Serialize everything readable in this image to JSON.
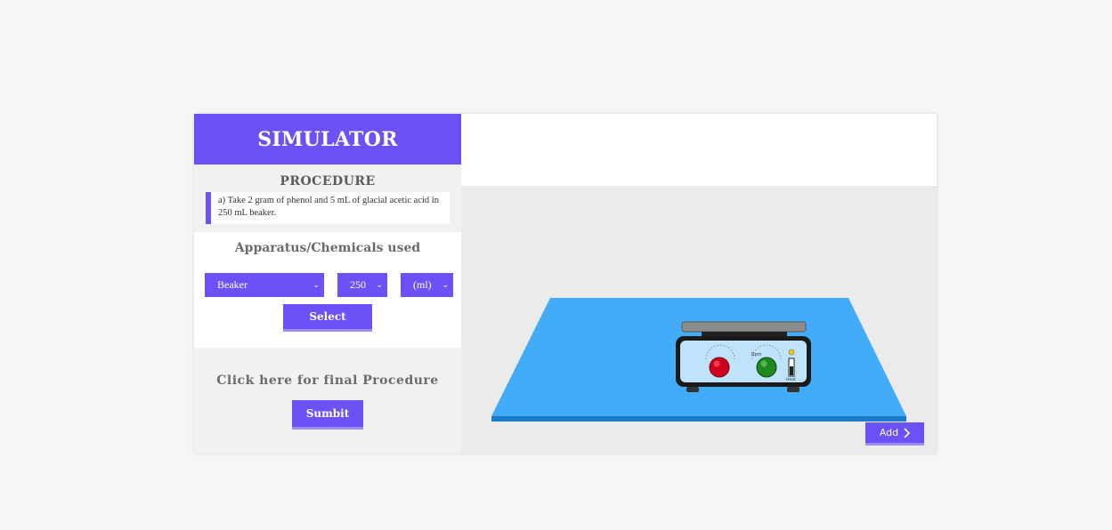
{
  "header": {
    "title": "SIMULATOR"
  },
  "procedure": {
    "title": "PROCEDURE",
    "step_text": "a) Take 2 gram of phenol and 5 mL of glacial acetic acid in 250 mL beaker."
  },
  "apparatus": {
    "title": "Apparatus/Chemicals used",
    "item_select": {
      "value": "Beaker"
    },
    "size_select": {
      "value": "250"
    },
    "unit_select": {
      "value": "(ml)"
    },
    "select_button": "Select"
  },
  "final": {
    "label": "Click here for final Procedure",
    "submit_button": "Sumbit"
  },
  "hotplate": {
    "dial_label": "Rpm",
    "switch_label": "Heat"
  },
  "add_button": {
    "label": "Add",
    "icon": "chevron-right-icon"
  },
  "colors": {
    "accent": "#6a52f7",
    "table": "#42acf8",
    "knob_left": "#d0021b",
    "knob_right": "#1f8a1f"
  }
}
